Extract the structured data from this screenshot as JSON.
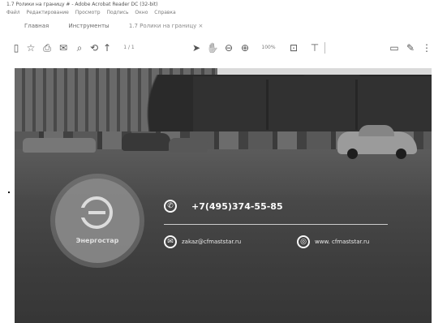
{
  "window": {
    "title": "1.7 Ролики на границу # - Adobe Acrobat Reader DC (32-bit)",
    "menu": [
      "Файл",
      "Редактирование",
      "Просмотр",
      "Подпись",
      "Окно",
      "Справка"
    ]
  },
  "tabs": [
    {
      "label": "Главная"
    },
    {
      "label": "Инструменты"
    },
    {
      "label": "1.7 Ролики на границу ×"
    }
  ],
  "toolbar": {
    "page_current": "1",
    "page_total": "/ 1",
    "zoom": "100%",
    "icons": [
      "save-icon",
      "bookmark-star-icon",
      "print-icon",
      "email-icon",
      "search-zoom-icon",
      "upload-icon",
      "prev-page-icon",
      "next-page-icon",
      "pointer-icon",
      "hand-icon",
      "zoom-out-icon",
      "zoom-in-icon",
      "fit-page-icon",
      "comment-icon",
      "sign-icon",
      "annotate-icon"
    ]
  },
  "document": {
    "logo_text": "Энергостар",
    "phone": "+7(495)374-55-85",
    "email": "zakaz@cfmaststar.ru",
    "website": "www. cfmaststar.ru"
  }
}
